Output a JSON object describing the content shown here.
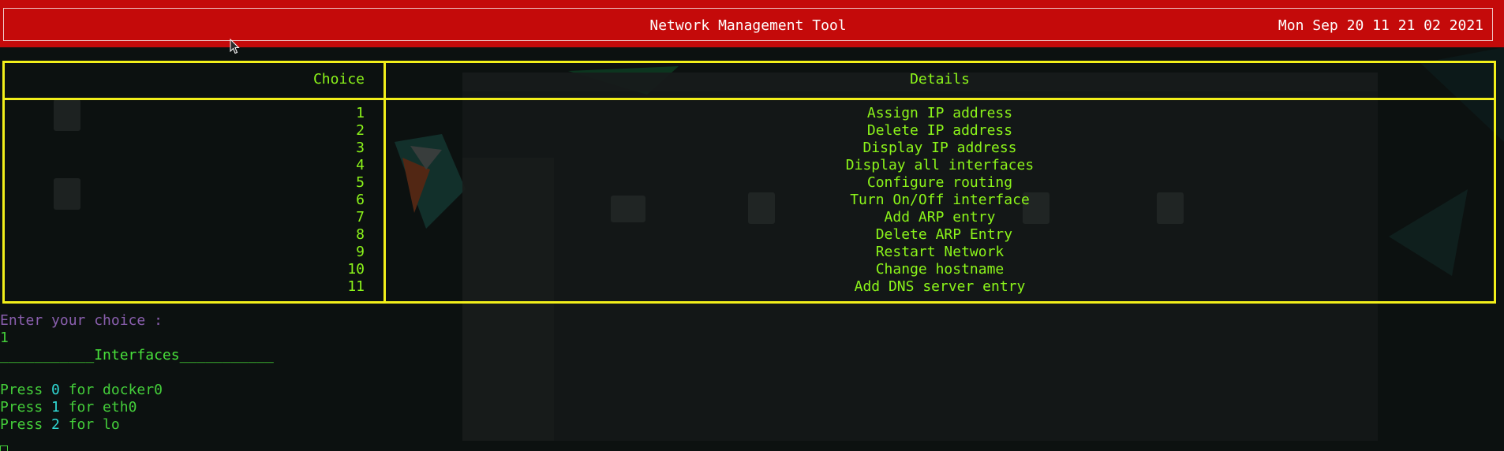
{
  "window": {
    "title": "Network Management Tool",
    "datetime": "Mon Sep 20 11 21 02 2021"
  },
  "menu": {
    "headers": {
      "choice": "Choice",
      "details": "Details"
    },
    "items": [
      {
        "choice": "1",
        "detail": "Assign IP address"
      },
      {
        "choice": "2",
        "detail": "Delete IP address"
      },
      {
        "choice": "3",
        "detail": "Display IP address"
      },
      {
        "choice": "4",
        "detail": "Display all interfaces"
      },
      {
        "choice": "5",
        "detail": "Configure routing"
      },
      {
        "choice": "6",
        "detail": "Turn On/Off interface"
      },
      {
        "choice": "7",
        "detail": "Add ARP entry"
      },
      {
        "choice": "8",
        "detail": " Delete ARP Entry"
      },
      {
        "choice": "9",
        "detail": "Restart Network"
      },
      {
        "choice": "10",
        "detail": "Change hostname"
      },
      {
        "choice": "11",
        "detail": "Add DNS server entry"
      }
    ]
  },
  "console": {
    "prompt": "Enter your choice :",
    "input": "1",
    "section_title": "___________Interfaces___________",
    "interface_options": [
      {
        "prefix": "Press ",
        "key": "0",
        "suffix": " for docker0"
      },
      {
        "prefix": "Press ",
        "key": "1",
        "suffix": " for eth0"
      },
      {
        "prefix": "Press ",
        "key": "2",
        "suffix": " for lo"
      }
    ]
  },
  "colors": {
    "titlebar_bg": "#c40a0a",
    "table_border": "#f2ef1a",
    "menu_text": "#8cf51a",
    "prompt_text": "#8a5fae",
    "console_text": "#44ce3a",
    "key_text": "#30d8d4"
  },
  "icons": [
    "mouse-pointer-icon"
  ]
}
